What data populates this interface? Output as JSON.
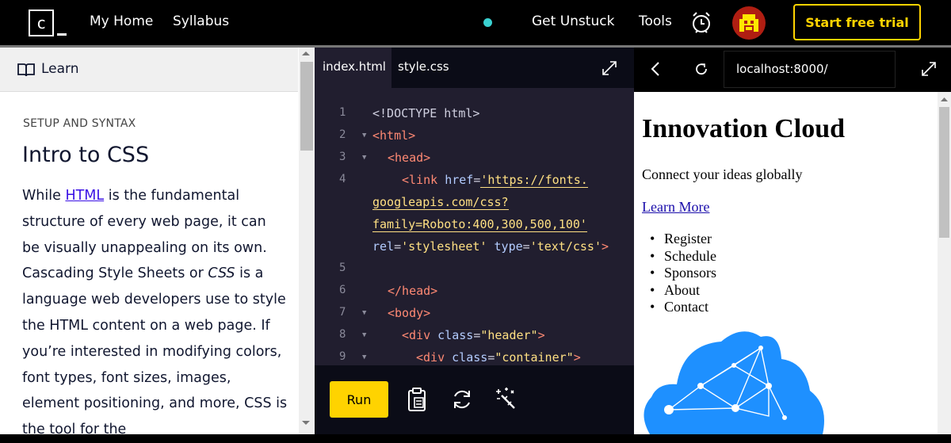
{
  "header": {
    "logo_letter": "c",
    "nav": [
      "My Home",
      "Syllabus",
      "Get Unstuck",
      "Tools"
    ],
    "cta": "Start free trial",
    "status_dot_color": "#3ad1d1",
    "cta_color": "#ffd300"
  },
  "learn": {
    "panel_label": "Learn",
    "section": "SETUP AND SYNTAX",
    "title": "Intro to CSS",
    "p_before_link": "While ",
    "p_link": "HTML",
    "p_after_link": " is the fundamental structure of every web page, it can be visually unappealing on its own. Cascading Style Sheets or ",
    "p_css": "CSS",
    "p_tail": " is a language web developers use to style the HTML content on a web page. If you’re interested in modifying colors, font types, font sizes, images, element positioning, and more, CSS is the tool for the"
  },
  "editor": {
    "tabs": [
      "index.html",
      "style.css"
    ],
    "line_numbers": [
      "1",
      "2",
      "3",
      "4",
      "5",
      "6",
      "7",
      "8",
      "9"
    ],
    "run_label": "Run",
    "code": {
      "l1": "<!DOCTYPE html>",
      "l2": "<html>",
      "l3": "<head>",
      "l4a_tag": "<link ",
      "l4a_attr": "href",
      "l4a_eq": "=",
      "l4a_str": "'https://fonts.",
      "l4b_str": "googleapis.com/css?",
      "l4c_str": "family=Roboto:400,300,500,100'",
      "l4d_attr1": "rel",
      "l4d_eq": "=",
      "l4d_str1": "'stylesheet'",
      "l4d_attr2": "type",
      "l4d_str2": "'text/css'",
      "l4d_close": ">",
      "l6": "</head>",
      "l7": "<body>",
      "l8_tag": "<div ",
      "l8_attr": "class",
      "l8_eq": "=",
      "l8_str": "\"header\"",
      "l8_close": ">",
      "l9_tag": "<div ",
      "l9_attr": "class",
      "l9_eq": "=",
      "l9_str": "\"container\"",
      "l9_close": ">"
    }
  },
  "browser": {
    "url": "localhost:8000/",
    "h1": "Innovation Cloud",
    "subtitle": "Connect your ideas globally",
    "link": "Learn More",
    "list": [
      "Register",
      "Schedule",
      "Sponsors",
      "About",
      "Contact"
    ],
    "cloud_color": "#1e90ff"
  }
}
